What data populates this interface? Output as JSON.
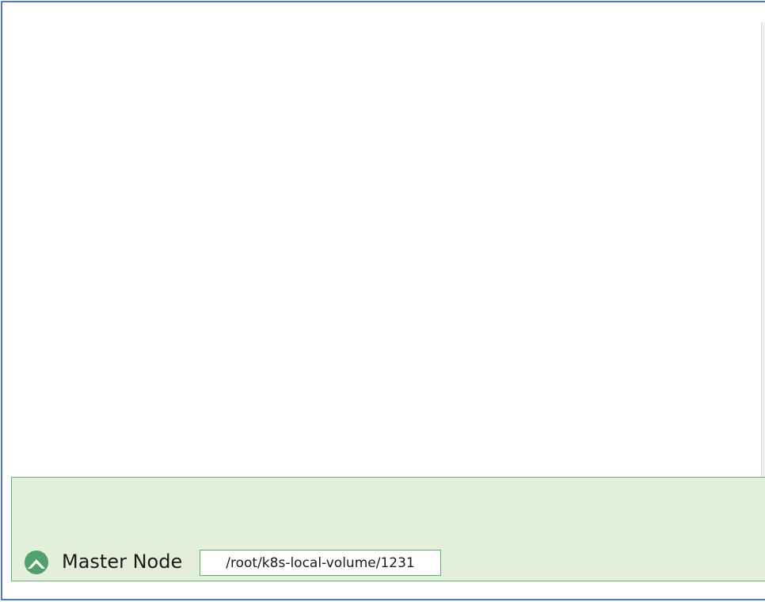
{
  "node": {
    "label": "Master Node",
    "path": "/root/k8s-local-volume/1231",
    "icon": "rancher-logo-icon"
  },
  "colors": {
    "frame_border": "#4a78c4",
    "panel_fill": "#e3efda",
    "panel_border": "#5cb46c",
    "icon_fill": "#4fa06a"
  }
}
